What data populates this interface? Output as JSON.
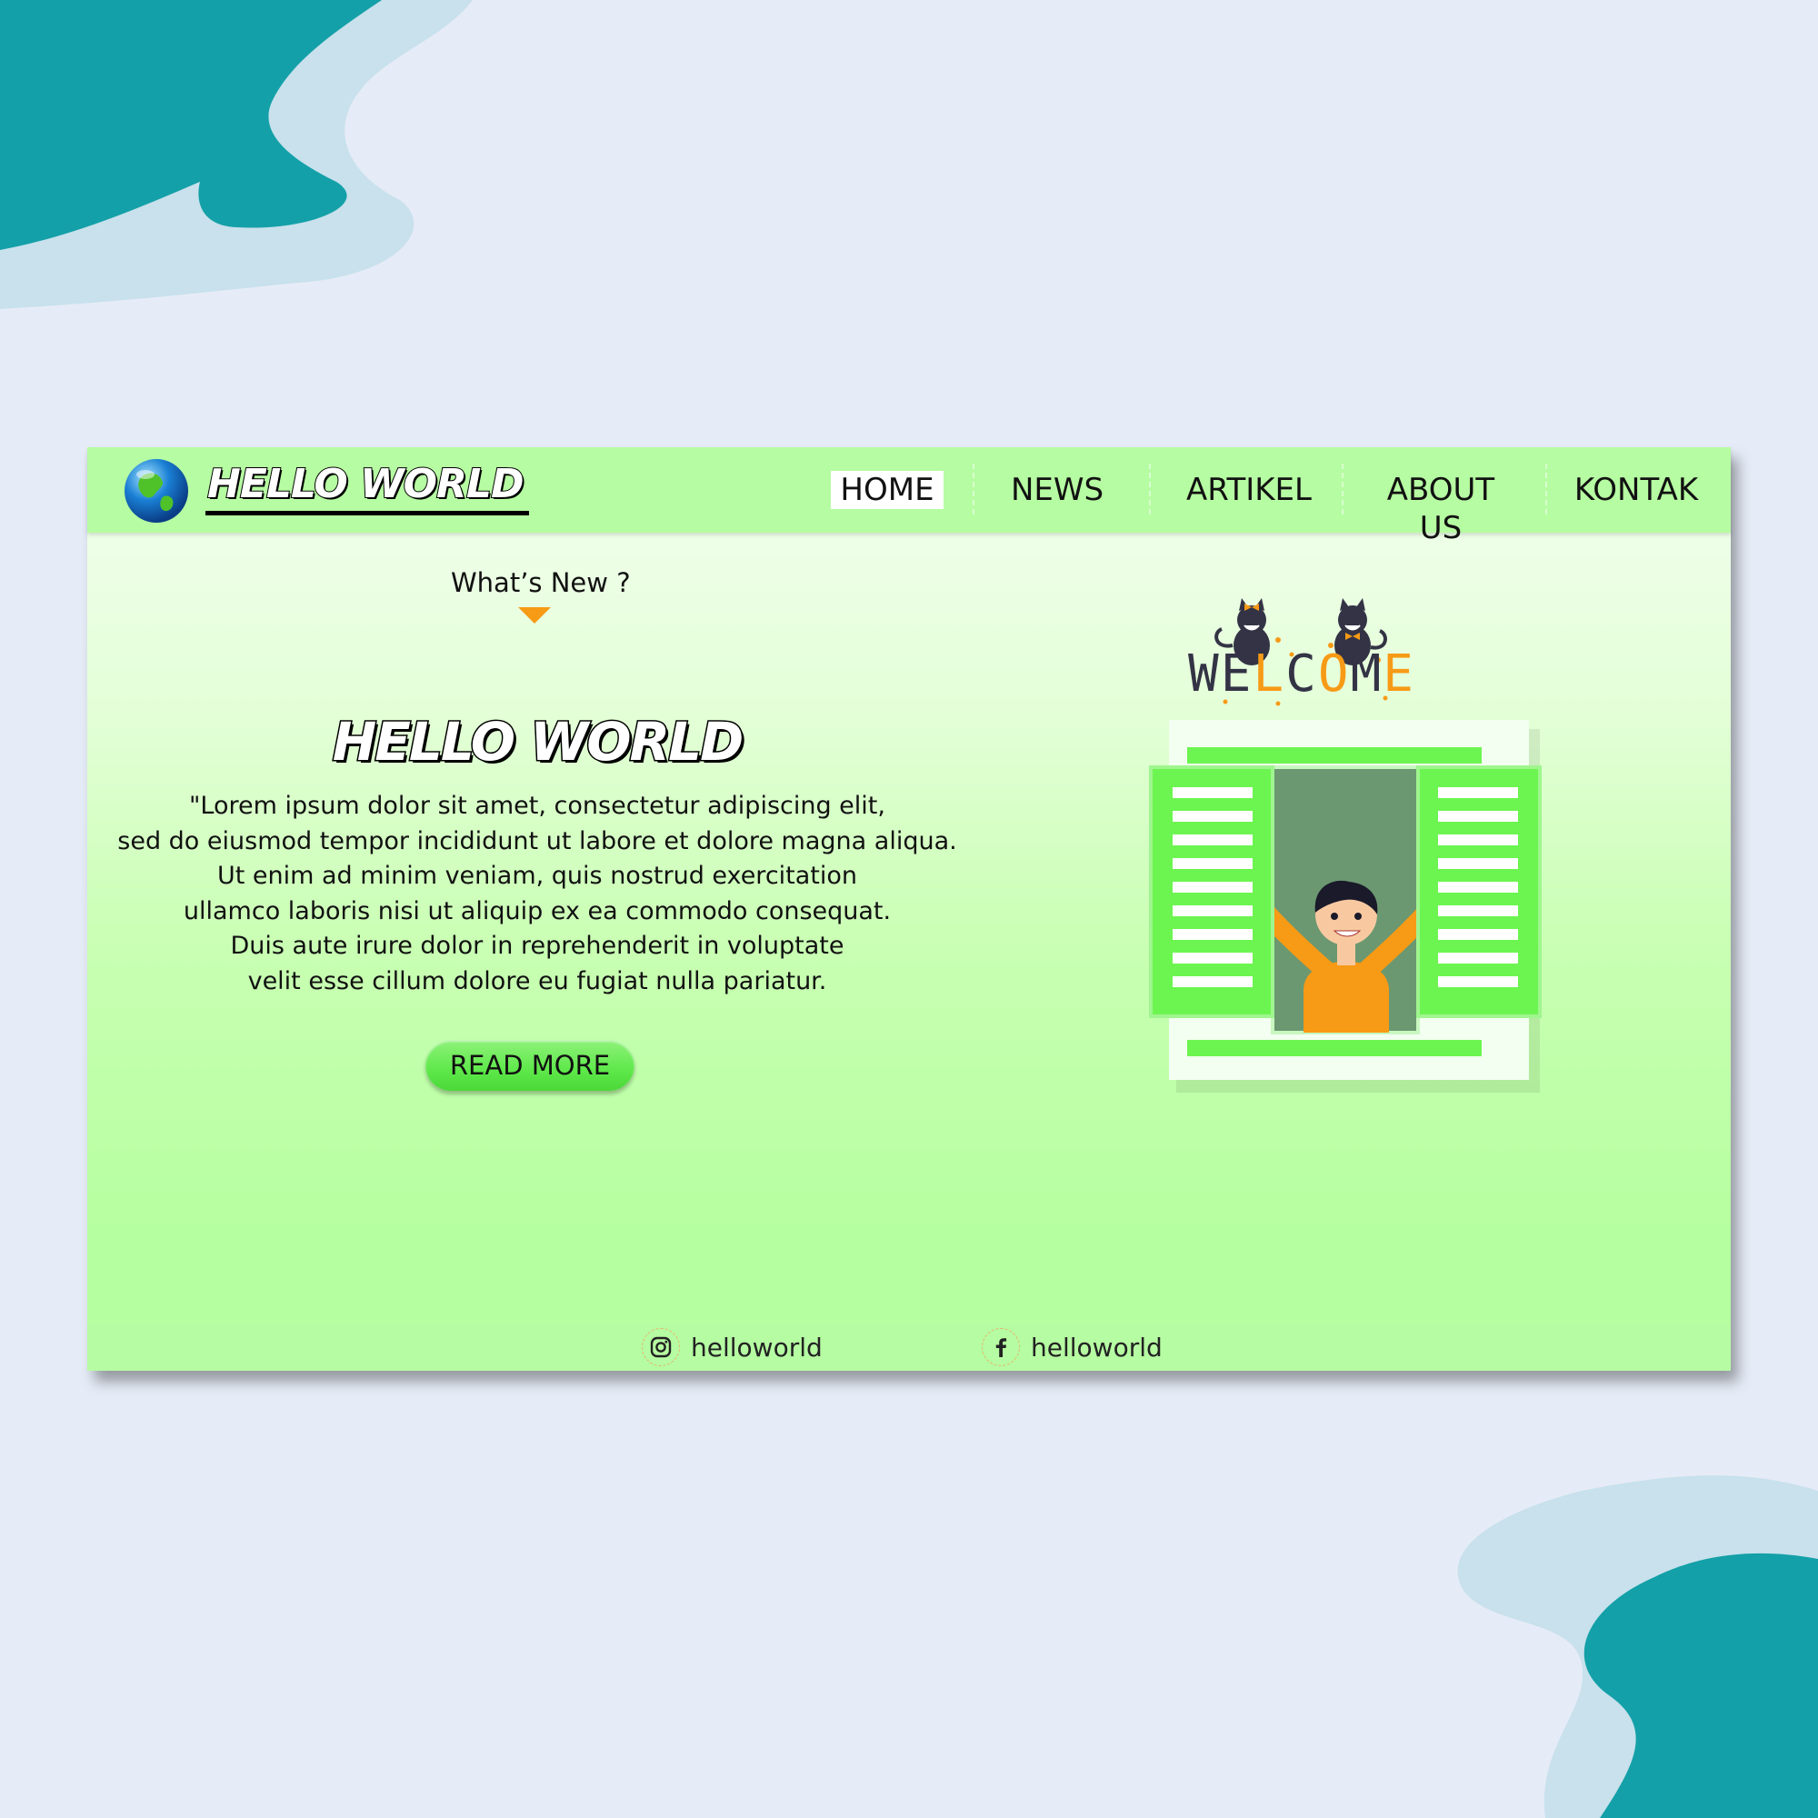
{
  "colors": {
    "page_background": "#e6ecf7",
    "decoration_teal": "#14a0a8",
    "decoration_light": "#c8e1ec",
    "header_green": "#b6fca2",
    "button_green": "#5ee84a",
    "accent_orange": "#f79a16"
  },
  "header": {
    "logo_icon": "globe-icon",
    "brand": "HELLO WORLD",
    "nav": [
      {
        "label": "HOME",
        "active": true
      },
      {
        "label": "NEWS",
        "active": false
      },
      {
        "label": "ARTIKEL",
        "active": false
      },
      {
        "label": "ABOUT US",
        "active": false
      },
      {
        "label": "KONTAK",
        "active": false
      }
    ]
  },
  "hero": {
    "whats_new": "What’s New ?",
    "title": "HELLO WORLD",
    "body_lines": [
      "\"Lorem ipsum dolor sit amet, consectetur adipiscing elit,",
      "sed do eiusmod tempor incididunt ut labore et dolore magna aliqua.",
      "Ut enim ad minim veniam, quis nostrud exercitation",
      "ullamco laboris nisi ut aliquip ex ea commodo consequat.",
      "Duis aute irure dolor in reprehenderit in voluptate",
      "velit esse cillum dolore eu fugiat nulla pariatur."
    ],
    "button": "READ MORE"
  },
  "illustration": {
    "welcome_text": "WELCOME",
    "scene": "cats-on-welcome-sign-and-boy-waving-from-window"
  },
  "footer": {
    "instagram": {
      "icon": "instagram-icon",
      "handle": "helloworld"
    },
    "facebook": {
      "icon": "facebook-icon",
      "handle": "helloworld"
    }
  }
}
